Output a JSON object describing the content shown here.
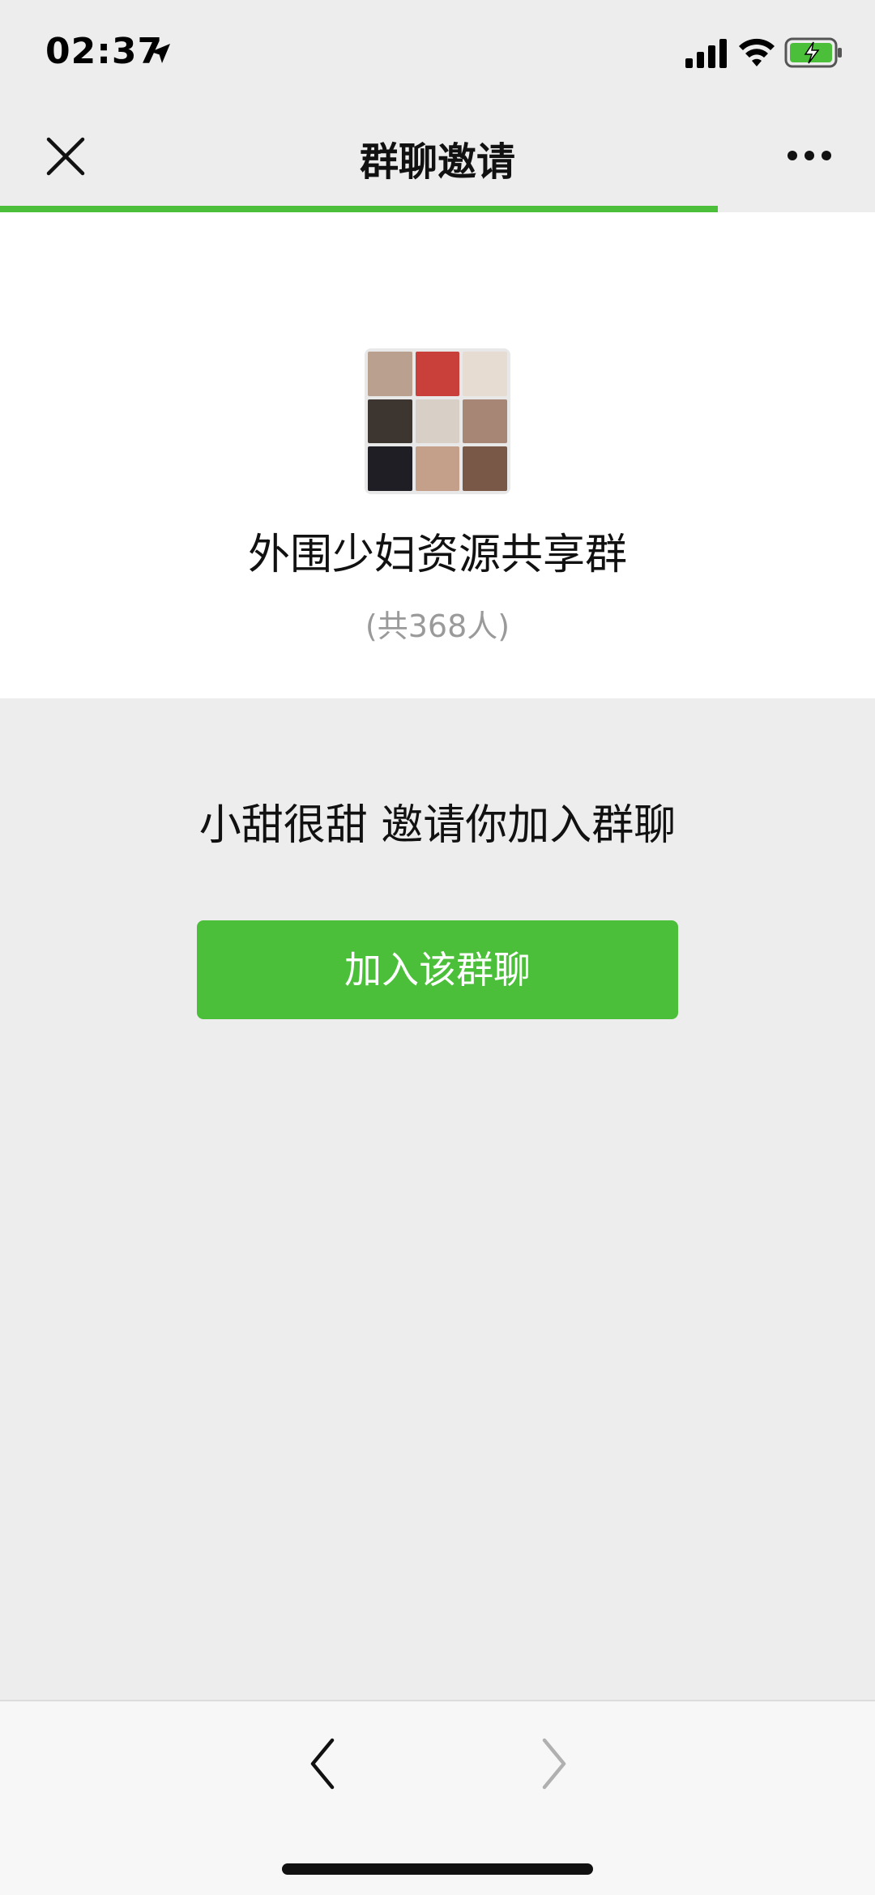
{
  "status_bar": {
    "time": "02:37",
    "icons": [
      "location-arrow-icon",
      "cellular-signal-icon",
      "wifi-icon",
      "battery-charging-icon"
    ]
  },
  "nav": {
    "title": "群聊邀请",
    "close_icon": "close-icon",
    "more_icon": "more-icon",
    "load_progress": 0.82
  },
  "group": {
    "name": "外围少妇资源共享群",
    "member_count": "(共368人)"
  },
  "invite": {
    "text": "小甜很甜  邀请你加入群聊",
    "join_button_label": "加入该群聊"
  },
  "toolbar": {
    "back_icon": "chevron-left-icon",
    "forward_icon": "chevron-right-icon"
  },
  "colors": {
    "accent_green": "#4cbf3a",
    "background_gray": "#ededed",
    "card_white": "#ffffff",
    "muted_text": "#9a9a9a"
  }
}
